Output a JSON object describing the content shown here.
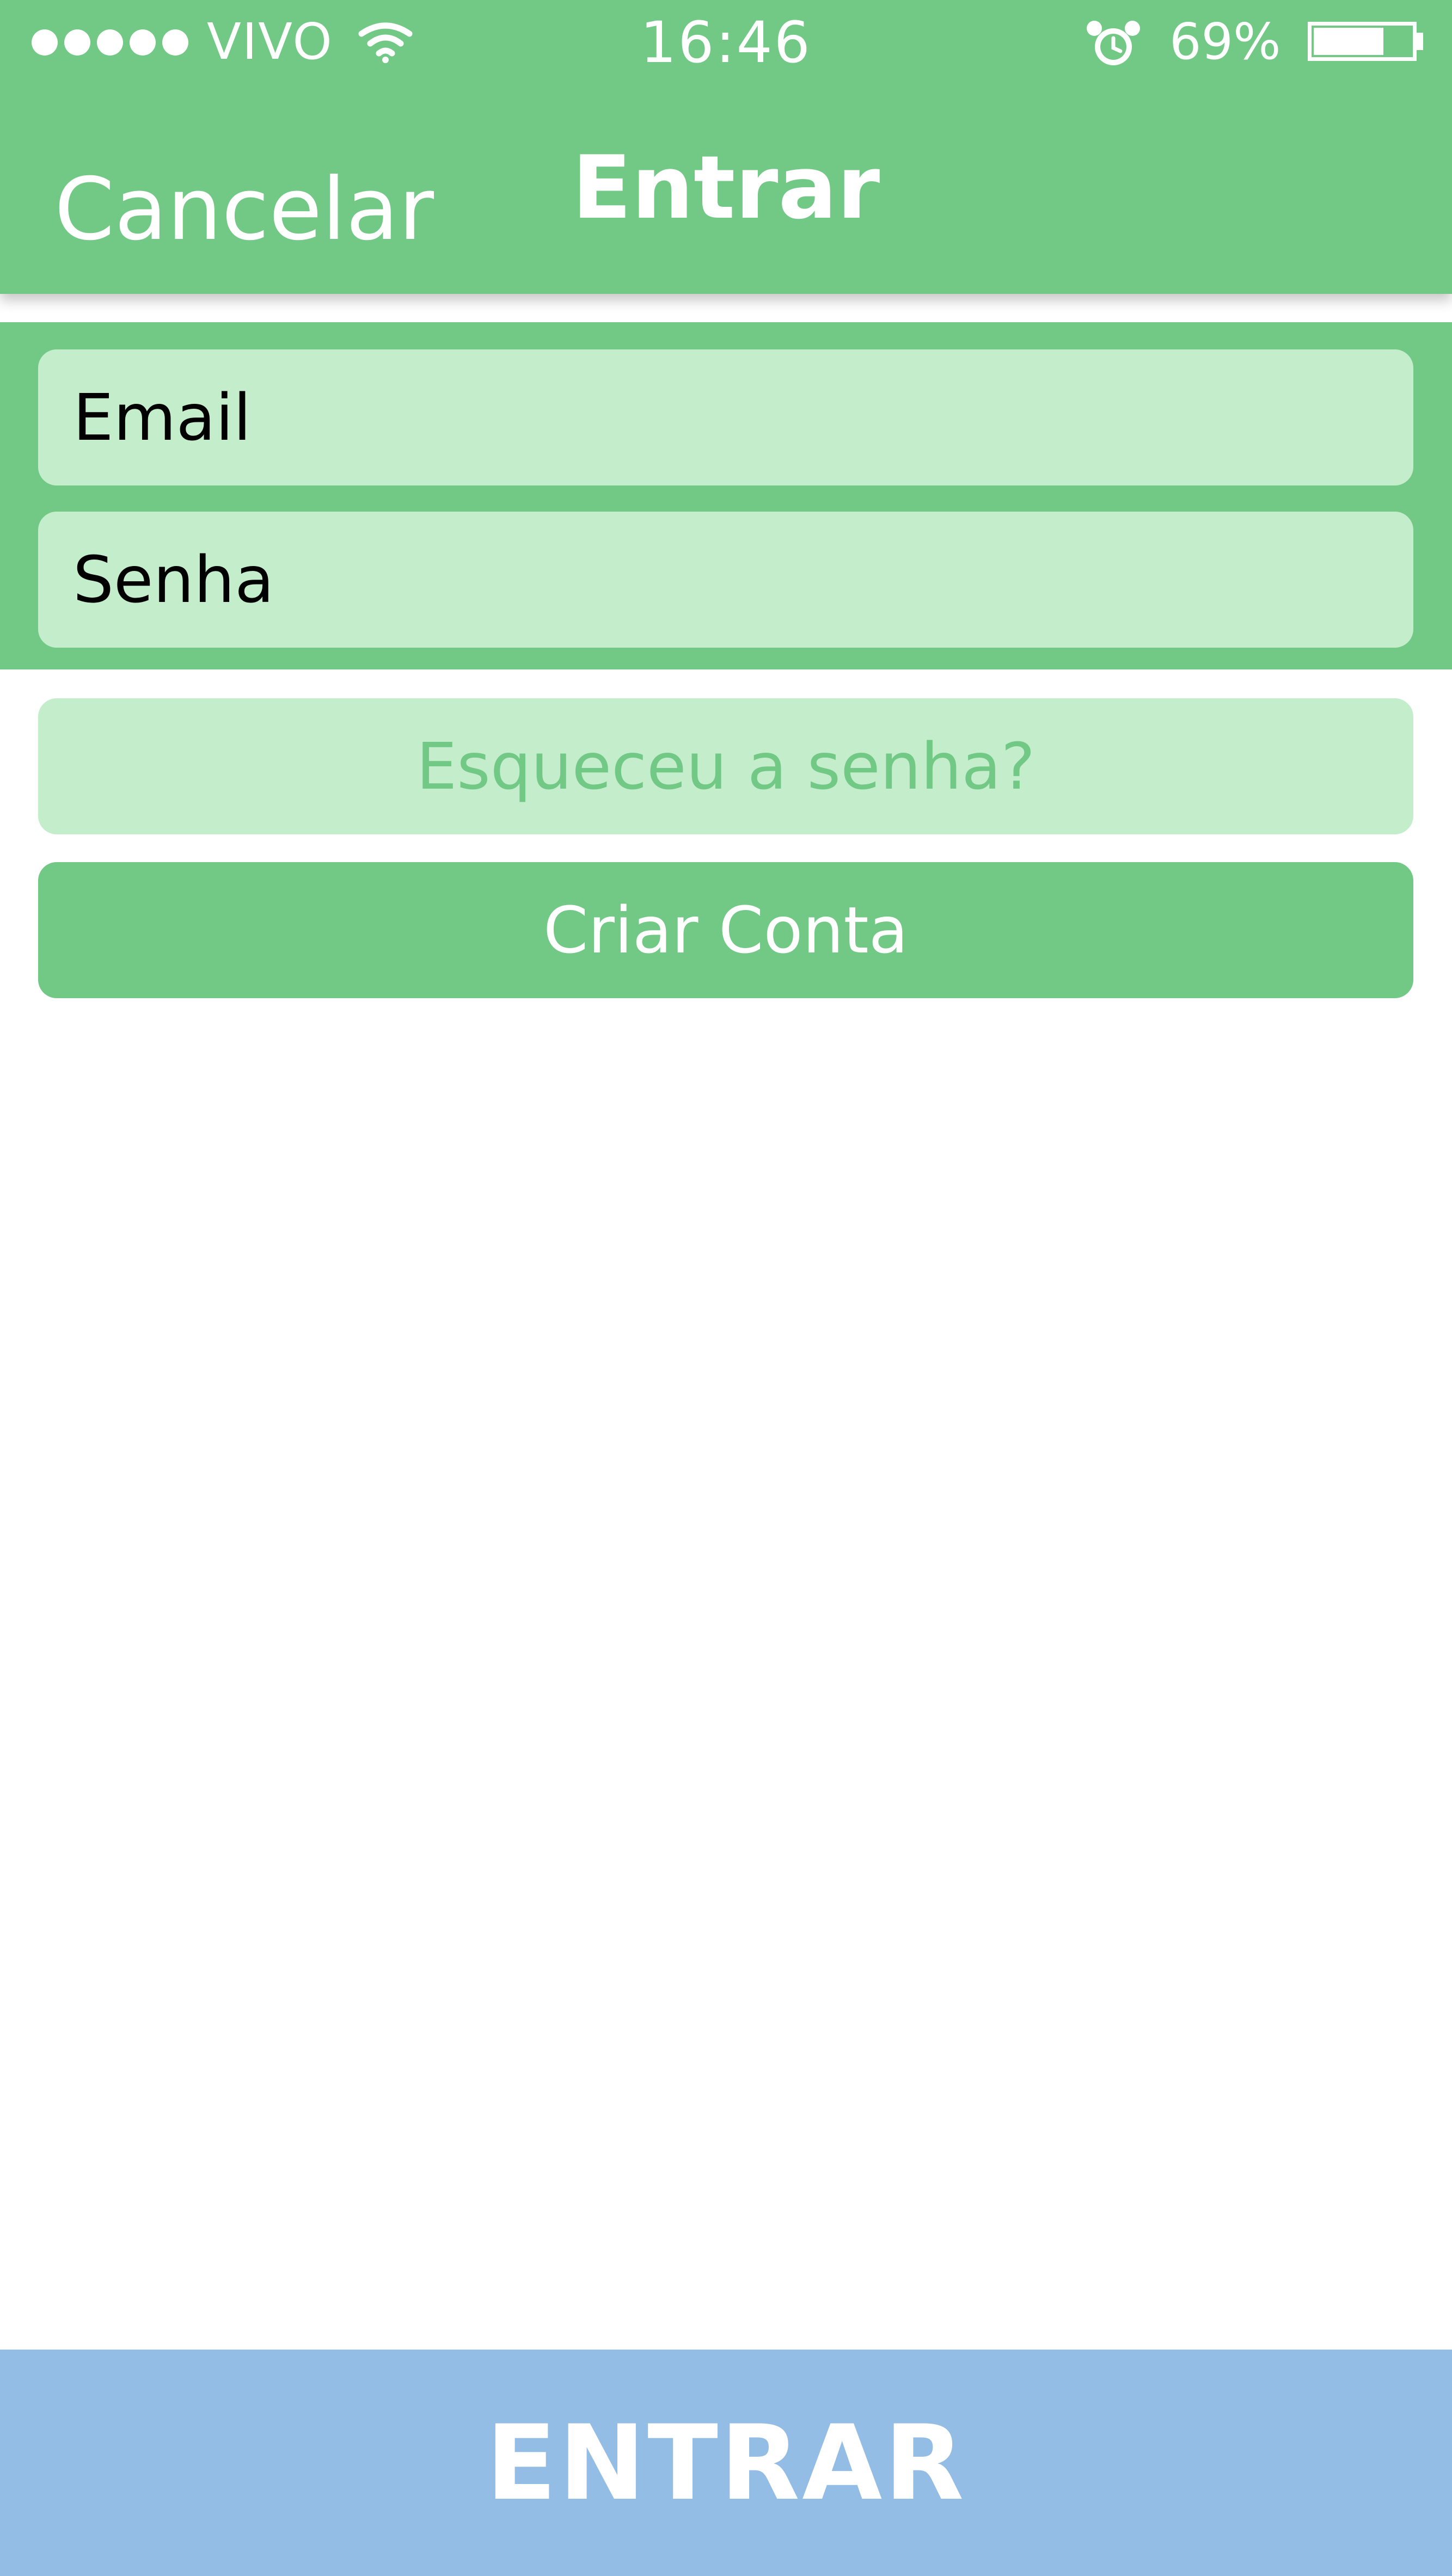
{
  "status_bar": {
    "signal_icon": "signal-dots-icon",
    "carrier": "VIVO",
    "wifi_icon": "wifi-icon",
    "time": "16:46",
    "alarm_icon": "alarm-clock-icon",
    "battery_percent": "69%",
    "battery_level": 0.69,
    "battery_icon": "battery-icon"
  },
  "nav": {
    "cancel_label": "Cancelar",
    "title": "Entrar"
  },
  "form": {
    "email_placeholder": "Email",
    "password_placeholder": "Senha",
    "forgot_label": "Esqueceu a senha?",
    "create_account_label": "Criar Conta"
  },
  "footer": {
    "enter_label": "ENTRAR"
  },
  "colors": {
    "primary_green": "#72c986",
    "light_green": "#c4edcb",
    "enter_blue": "#94bde5",
    "white": "#ffffff"
  }
}
